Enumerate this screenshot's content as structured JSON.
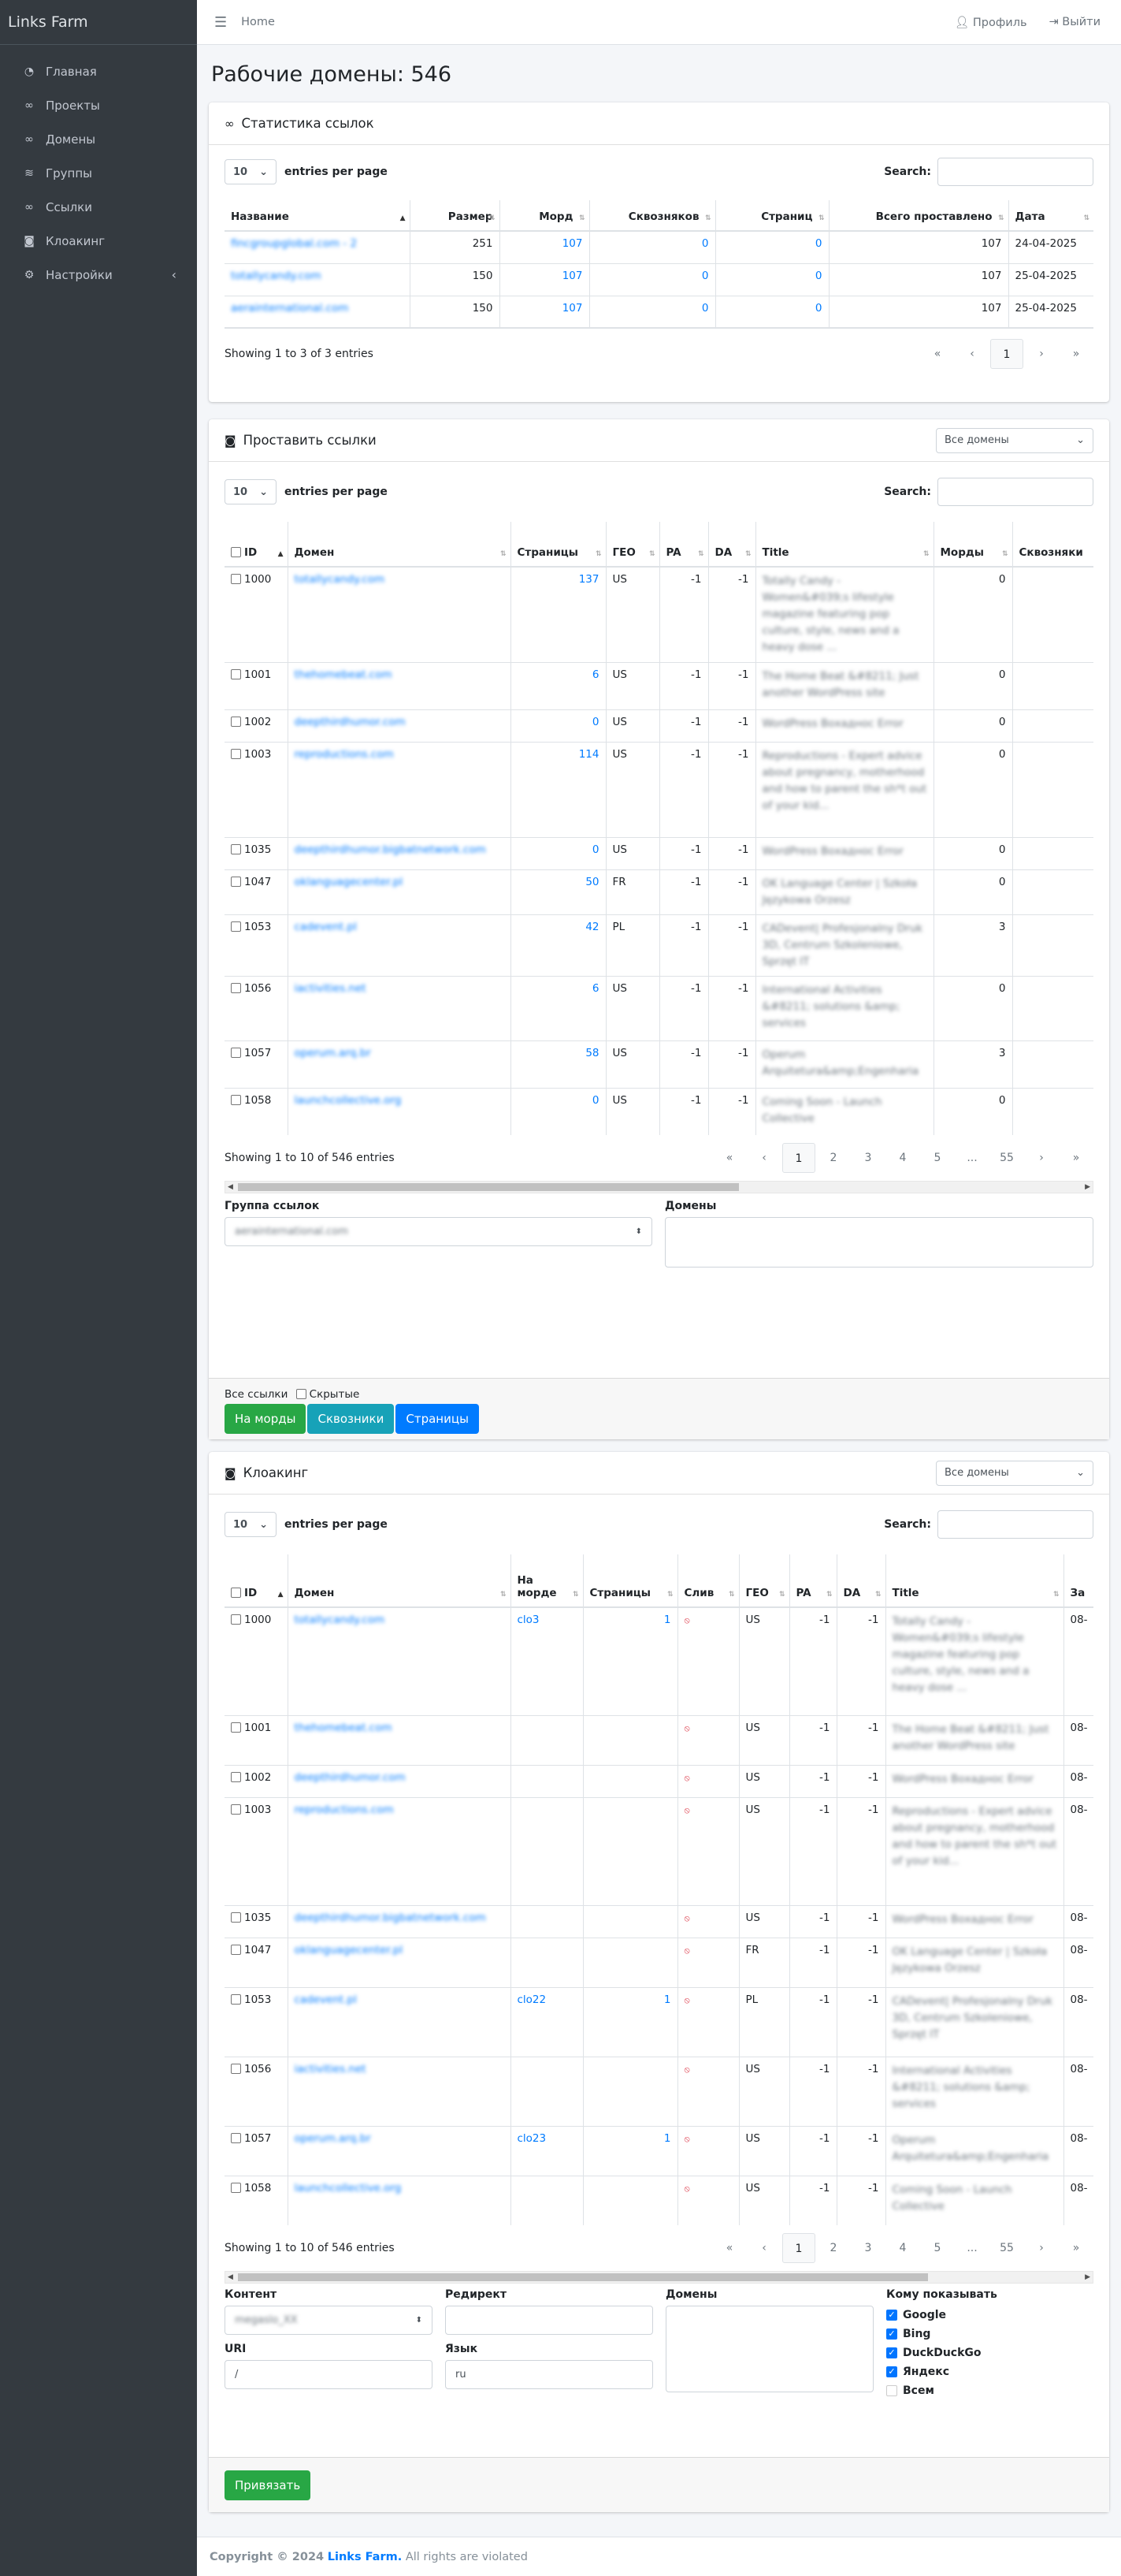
{
  "brand": "Links Farm",
  "sidebar": {
    "items": [
      {
        "label": "Главная",
        "icon": "speedometer-icon"
      },
      {
        "label": "Проекты",
        "icon": "link-icon"
      },
      {
        "label": "Домены",
        "icon": "link-icon"
      },
      {
        "label": "Группы",
        "icon": "layers-icon"
      },
      {
        "label": "Ссылки",
        "icon": "link-icon"
      },
      {
        "label": "Клоакинг",
        "icon": "mask-icon"
      },
      {
        "label": "Настройки",
        "icon": "gears-icon"
      }
    ]
  },
  "topbar": {
    "menu_icon": "hamburger-icon",
    "home": "Home",
    "profile": "Профиль",
    "logout": "Выйти"
  },
  "page_title": "Рабочие домены: 546",
  "stats": {
    "title": "Статистика ссылок",
    "length_value": "10",
    "length_label": "entries per page",
    "search_label": "Search:",
    "columns": [
      "Название",
      "Размер",
      "Морд",
      "Сквозняков",
      "Страниц",
      "Всего проставлено",
      "Дата"
    ],
    "rows": [
      [
        "fincgroupglobal.com - 2",
        "251",
        "107",
        "0",
        "0",
        "107",
        "24-04-2025"
      ],
      [
        "totallycandy.com",
        "150",
        "107",
        "0",
        "0",
        "107",
        "25-04-2025"
      ],
      [
        "aerainternational.com",
        "150",
        "107",
        "0",
        "0",
        "107",
        "25-04-2025"
      ]
    ],
    "info": "Showing 1 to 3 of 3 entries",
    "pages": [
      "«",
      "‹",
      "1",
      "›",
      "»"
    ]
  },
  "place": {
    "title": "Проставить ссылки",
    "filter": "Все домены",
    "length_value": "10",
    "length_label": "entries per page",
    "search_label": "Search:",
    "columns": [
      "ID",
      "Домен",
      "Страницы",
      "ГЕО",
      "PA",
      "DA",
      "Title",
      "Морды",
      "Сквозняки"
    ],
    "rows": [
      [
        "1000",
        "totallycandy.com",
        "137",
        "US",
        "-1",
        "-1",
        "Totally Candy - Women&#039;s lifestyle magazine featuring pop culture, style, news and a heavy dose ...",
        "0"
      ],
      [
        "1001",
        "thehomebeat.com",
        "6",
        "US",
        "-1",
        "-1",
        "The Home Beat &#8211; Just another WordPress site",
        "0"
      ],
      [
        "1002",
        "deepthirdhumor.com",
        "0",
        "US",
        "-1",
        "-1",
        "WordPress Вохаднос Error",
        "0"
      ],
      [
        "1003",
        "reproductions.com",
        "114",
        "US",
        "-1",
        "-1",
        "Reproductions - Expert advice about pregnancy, motherhood and how to parent the sh*t out of your kid...",
        "0"
      ],
      [
        "1035",
        "deepthirdhumor.bigbatnetwork.com",
        "0",
        "US",
        "-1",
        "-1",
        "WordPress Вохаднос Error",
        "0"
      ],
      [
        "1047",
        "oklanguagecenter.pl",
        "50",
        "FR",
        "-1",
        "-1",
        "OK Language Center | Szkoła Językowa Orzesz",
        "0"
      ],
      [
        "1053",
        "cadevent.pl",
        "42",
        "PL",
        "-1",
        "-1",
        "CADevent| Profesjonalny Druk 3D, Centrum Szkoleniowe, Sprzęt IT",
        "3"
      ],
      [
        "1056",
        "iactivities.net",
        "6",
        "US",
        "-1",
        "-1",
        "International Activities &#8211; solutions &amp; services",
        "0"
      ],
      [
        "1057",
        "operum.arq.br",
        "58",
        "US",
        "-1",
        "-1",
        "Operum Arquitetura&amp;Engenharia",
        "3"
      ],
      [
        "1058",
        "launchcollective.org",
        "0",
        "US",
        "-1",
        "-1",
        "Coming Soon - Launch Collective",
        "0"
      ]
    ],
    "info": "Showing 1 to 10 of 546 entries",
    "pages": [
      "«",
      "‹",
      "1",
      "2",
      "3",
      "4",
      "5",
      "...",
      "55",
      "›",
      "»"
    ],
    "group_label": "Группа ссылок",
    "group_value": "aerainternational.com",
    "domains_label": "Домены",
    "all_links": "Все ссылки",
    "hidden": "Скрытые",
    "buttons": [
      "На морды",
      "Сквозники",
      "Страницы"
    ]
  },
  "cloak": {
    "title": "Клоакинг",
    "filter": "Все домены",
    "length_value": "10",
    "length_label": "entries per page",
    "search_label": "Search:",
    "columns": [
      "ID",
      "Домен",
      "На морде",
      "Страницы",
      "Слив",
      "ГЕО",
      "PA",
      "DA",
      "Title",
      "За"
    ],
    "rows": [
      [
        "1000",
        "totallycandy.com",
        "clo3",
        "1",
        "US",
        "-1",
        "-1",
        "Totally Candy - Women&#039;s lifestyle magazine featuring pop culture, style, news and a heavy dose ...",
        "08-"
      ],
      [
        "1001",
        "thehomebeat.com",
        "",
        "",
        "US",
        "-1",
        "-1",
        "The Home Beat &#8211; Just another WordPress site",
        "08-"
      ],
      [
        "1002",
        "deepthirdhumor.com",
        "",
        "",
        "US",
        "-1",
        "-1",
        "WordPress Вохаднос Error",
        "08-"
      ],
      [
        "1003",
        "reproductions.com",
        "",
        "",
        "US",
        "-1",
        "-1",
        "Reproductions - Expert advice about pregnancy, motherhood and how to parent the sh*t out of your kid...",
        "08-"
      ],
      [
        "1035",
        "deepthirdhumor.bigbatnetwork.com",
        "",
        "",
        "US",
        "-1",
        "-1",
        "WordPress Вохаднос Error",
        "08-"
      ],
      [
        "1047",
        "oklanguagecenter.pl",
        "",
        "",
        "FR",
        "-1",
        "-1",
        "OK Language Center | Szkoła Językowa Orzesz",
        "08-"
      ],
      [
        "1053",
        "cadevent.pl",
        "clo22",
        "1",
        "PL",
        "-1",
        "-1",
        "CADevent| Profesjonalny Druk 3D, Centrum Szkoleniowe, Sprzęt IT",
        "08-"
      ],
      [
        "1056",
        "iactivities.net",
        "",
        "",
        "US",
        "-1",
        "-1",
        "International Activities &#8211; solutions &amp; services",
        "08-"
      ],
      [
        "1057",
        "operum.arq.br",
        "clo23",
        "1",
        "US",
        "-1",
        "-1",
        "Operum Arquitetura&amp;Engenharia",
        "08-"
      ],
      [
        "1058",
        "launchcollective.org",
        "",
        "",
        "US",
        "-1",
        "-1",
        "Coming Soon - Launch Collective",
        "08-"
      ]
    ],
    "info": "Showing 1 to 10 of 546 entries",
    "pages": [
      "«",
      "‹",
      "1",
      "2",
      "3",
      "4",
      "5",
      "...",
      "55",
      "›",
      "»"
    ],
    "content_label": "Контент",
    "content_value": "megaslo_XX",
    "redirect_label": "Редирект",
    "domains_label": "Домены",
    "uri_label": "URI",
    "uri_value": "/",
    "lang_label": "Язык",
    "lang_value": "ru",
    "show_label": "Кому показывать",
    "show_items": [
      {
        "label": "Google",
        "checked": true
      },
      {
        "label": "Bing",
        "checked": true
      },
      {
        "label": "DuckDuckGo",
        "checked": true
      },
      {
        "label": "Яндекс",
        "checked": true
      },
      {
        "label": "Всем",
        "checked": false
      }
    ],
    "bind_button": "Привязать"
  },
  "footer": {
    "copy": "Copyright © 2024",
    "brand": "Links Farm.",
    "rest": "All rights are violated"
  }
}
